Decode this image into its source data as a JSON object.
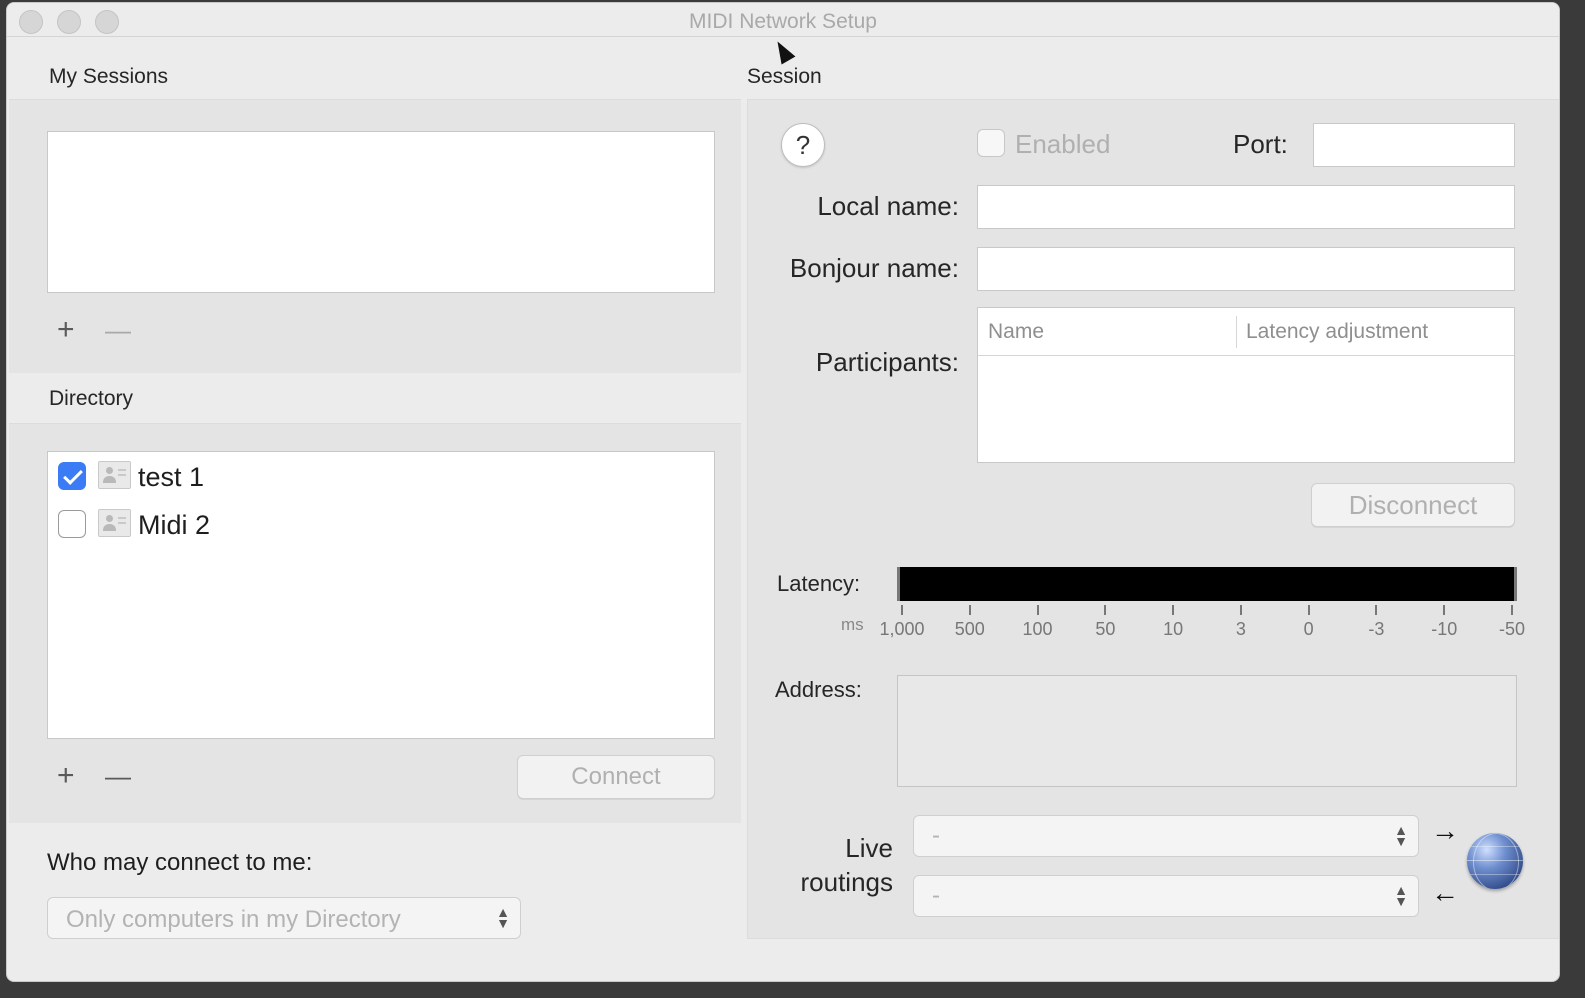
{
  "window": {
    "title": "MIDI Network Setup"
  },
  "my_sessions": {
    "label": "My Sessions",
    "add": "+",
    "remove": "—"
  },
  "directory": {
    "label": "Directory",
    "items": [
      {
        "name": "test 1",
        "checked": true
      },
      {
        "name": "Midi 2",
        "checked": false
      }
    ],
    "add": "+",
    "remove": "—",
    "connect_label": "Connect"
  },
  "who_may_connect": {
    "label": "Who may connect to me:",
    "selected": "Only computers in my Directory"
  },
  "session": {
    "label": "Session",
    "help": "?",
    "enabled_label": "Enabled",
    "port_label": "Port:",
    "local_name_label": "Local name:",
    "bonjour_name_label": "Bonjour name:",
    "participants_label": "Participants:",
    "columns": [
      "Name",
      "Latency adjustment"
    ],
    "disconnect_label": "Disconnect",
    "latency_label": "Latency:",
    "latency_unit": "ms",
    "latency_ticks": [
      "1,000",
      "500",
      "100",
      "50",
      "10",
      "3",
      "0",
      "-3",
      "-10",
      "-50"
    ],
    "address_label": "Address:",
    "live_routings_label_line1": "Live",
    "live_routings_label_line2": "routings",
    "routing_out": "-",
    "routing_in": "-",
    "arrow_out": "→",
    "arrow_in": "←"
  }
}
